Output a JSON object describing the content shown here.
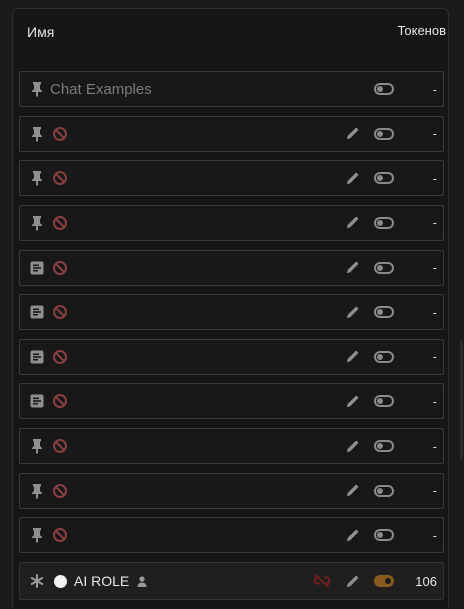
{
  "header": {
    "name_label": "Имя",
    "tokens_label": "Токенов"
  },
  "rows": [
    {
      "left_icon": "pin-icon",
      "name": "Chat Examples",
      "pencil": false,
      "toggle": "off",
      "tokens": "-"
    },
    {
      "left_icon": "pin-icon",
      "name": "",
      "pencil": true,
      "toggle": "off",
      "tokens": "-"
    },
    {
      "left_icon": "pin-icon",
      "name": "",
      "pencil": true,
      "toggle": "off",
      "tokens": "-"
    },
    {
      "left_icon": "pin-icon",
      "name": "",
      "pencil": true,
      "toggle": "off",
      "tokens": "-"
    },
    {
      "left_icon": "note-icon",
      "name": "",
      "pencil": true,
      "toggle": "off",
      "tokens": "-"
    },
    {
      "left_icon": "note-icon",
      "name": "",
      "pencil": true,
      "toggle": "off",
      "tokens": "-"
    },
    {
      "left_icon": "note-icon",
      "name": "",
      "pencil": true,
      "toggle": "off",
      "tokens": "-"
    },
    {
      "left_icon": "note-icon",
      "name": "",
      "pencil": true,
      "toggle": "off",
      "tokens": "-"
    },
    {
      "left_icon": "pin-icon",
      "name": "",
      "pencil": true,
      "toggle": "off",
      "tokens": "-"
    },
    {
      "left_icon": "pin-icon",
      "name": "",
      "pencil": true,
      "toggle": "off",
      "tokens": "-"
    },
    {
      "left_icon": "pin-icon",
      "name": "",
      "pencil": true,
      "toggle": "off",
      "tokens": "-"
    }
  ],
  "role_row": {
    "left_icon": "asterisk-icon",
    "name": "AI ROLE",
    "tokens": "106",
    "toggle": "on"
  },
  "colors": {
    "accent": "#8a5a1e",
    "blocked": "#8a3f3f",
    "link_broken": "#7a1f1f"
  }
}
